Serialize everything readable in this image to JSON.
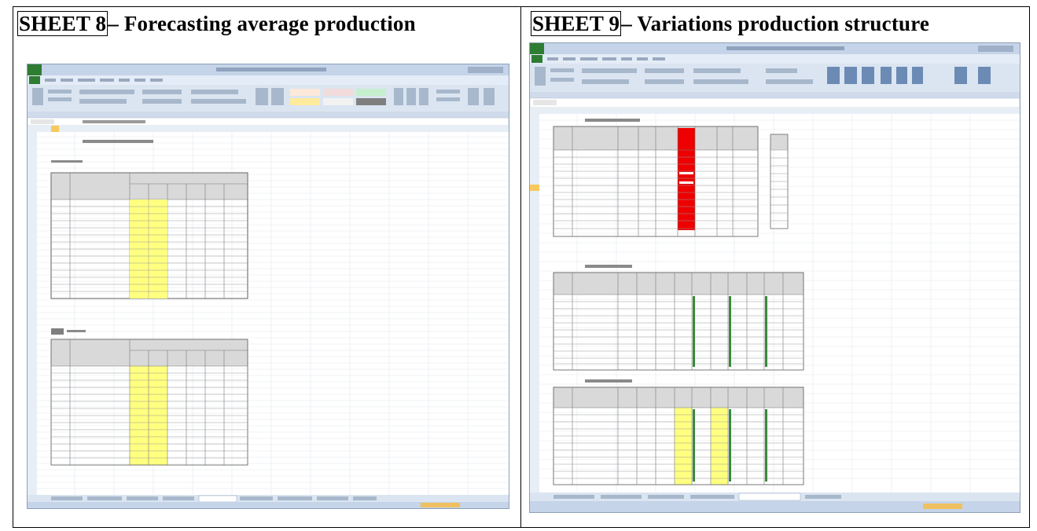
{
  "left": {
    "sheet_label": "SHEET 8",
    "title": "– Forecasting average production"
  },
  "right": {
    "sheet_label": "SHEET 9",
    "title": "– Variations production structure"
  },
  "colors": {
    "highlight_yellow": "#ffff80",
    "highlight_red": "#ee0000",
    "ribbon_blue": "#dbe5f1",
    "title_bar_blue": "#c5d4e8"
  }
}
